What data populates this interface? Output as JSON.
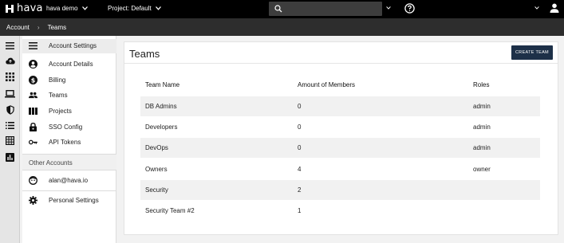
{
  "topbar": {
    "logo_text": "hava",
    "account_selector": "hava demo",
    "project_selector": "Project: Default",
    "search_placeholder": ""
  },
  "breadcrumb": [
    "Account",
    "Teams"
  ],
  "sidebar": {
    "items": [
      {
        "label": "Account Settings",
        "icon": "list-icon",
        "active": true
      },
      {
        "label": "Account Details",
        "icon": "account-circle-icon"
      },
      {
        "label": "Billing",
        "icon": "dollar-icon"
      },
      {
        "label": "Teams",
        "icon": "people-icon"
      },
      {
        "label": "Projects",
        "icon": "columns-icon"
      },
      {
        "label": "SSO Config",
        "icon": "lock-icon"
      },
      {
        "label": "API Tokens",
        "icon": "key-icon"
      }
    ],
    "section_label": "Other Accounts",
    "other_accounts": [
      {
        "label": "alan@hava.io",
        "icon": "face-icon"
      }
    ],
    "footer_items": [
      {
        "label": "Personal Settings",
        "icon": "gear-icon"
      }
    ]
  },
  "main": {
    "title": "Teams",
    "create_button": "CREATE TEAM",
    "table": {
      "headers": [
        "Team Name",
        "Amount of Members",
        "Roles"
      ],
      "rows": [
        [
          "DB Admins",
          "0",
          "admin"
        ],
        [
          "Developers",
          "0",
          "admin"
        ],
        [
          "DevOps",
          "0",
          "admin"
        ],
        [
          "Owners",
          "4",
          "owner"
        ],
        [
          "Security",
          "2",
          ""
        ],
        [
          "Security Team #2",
          "1",
          ""
        ]
      ]
    }
  },
  "colors": {
    "topbar_bg": "#000000",
    "breadcrumb_bg": "#2d2d2d",
    "button_bg": "#1d3048",
    "row_stripe": "#f1f1f1"
  }
}
